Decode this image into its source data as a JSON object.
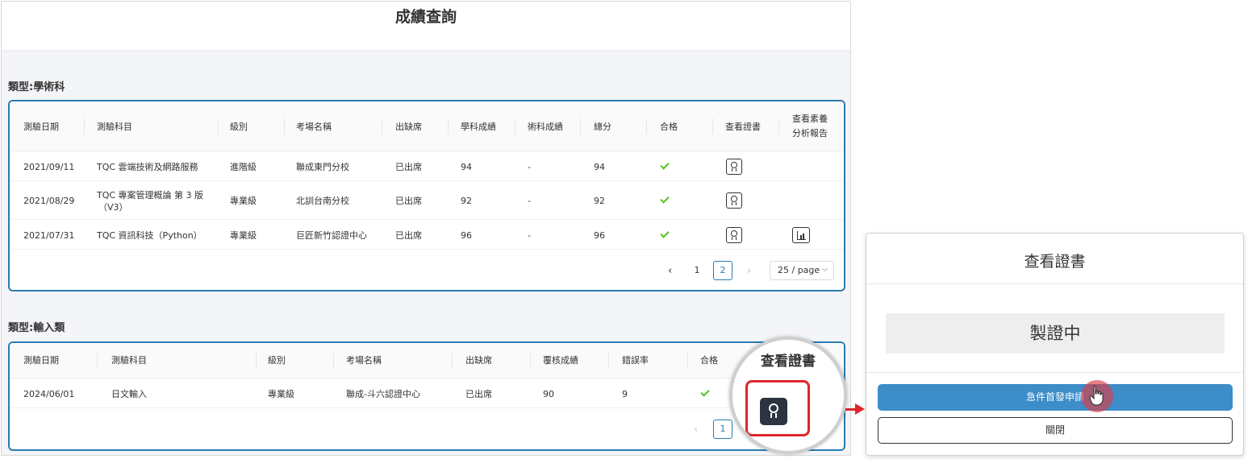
{
  "page": {
    "title": "成績查詢"
  },
  "academic": {
    "section_title": "類型:學術科",
    "headers": [
      "測驗日期",
      "測驗科目",
      "級別",
      "考場名稱",
      "出缺席",
      "學科成績",
      "術科成績",
      "總分",
      "合格",
      "查看證書",
      "查看素養",
      "分析報告"
    ],
    "rows": [
      {
        "date": "2021/09/11",
        "subject": "TQC 雲端技術及網路服務",
        "subject2": "",
        "level": "進階級",
        "venue": "聯成東門分校",
        "attendance": "已出席",
        "written": "94",
        "practical": "-",
        "total": "94",
        "has_report": false
      },
      {
        "date": "2021/08/29",
        "subject": "TQC 專案管理概論 第 3 版",
        "subject2": "（V3）",
        "level": "專業級",
        "venue": "北訓台南分校",
        "attendance": "已出席",
        "written": "92",
        "practical": "-",
        "total": "92",
        "has_report": false
      },
      {
        "date": "2021/07/31",
        "subject": "TQC 資訊科技（Python）",
        "subject2": "",
        "level": "專業級",
        "venue": "巨匠新竹認證中心",
        "attendance": "已出席",
        "written": "96",
        "practical": "-",
        "total": "96",
        "has_report": true
      }
    ],
    "pagination": {
      "prev": "‹",
      "next": "›",
      "pages": [
        "1",
        "2"
      ],
      "current": "2",
      "page_size": "25 / page"
    }
  },
  "typing": {
    "section_title": "類型:輸入類",
    "headers": [
      "測驗日期",
      "測驗科目",
      "級別",
      "考場名稱",
      "出缺席",
      "覆核成績",
      "錯誤率",
      "合格"
    ],
    "rows": [
      {
        "date": "2024/06/01",
        "subject": "日文輸入",
        "level": "專業級",
        "venue": "聯成-斗六認證中心",
        "attendance": "已出席",
        "score": "90",
        "error_rate": "9"
      }
    ],
    "pagination": {
      "prev": "‹",
      "pages": [
        "1"
      ],
      "current": "1"
    }
  },
  "magnifier": {
    "label": "查看證書"
  },
  "modal": {
    "title": "查看證書",
    "status": "製證中",
    "primary_button": "急件首發申請",
    "close_button": "關閉"
  },
  "colors": {
    "accent": "#2a7bb0",
    "primary_button": "#3c8dc8",
    "highlight_red": "#e0252b",
    "check_green": "#52c41a"
  }
}
